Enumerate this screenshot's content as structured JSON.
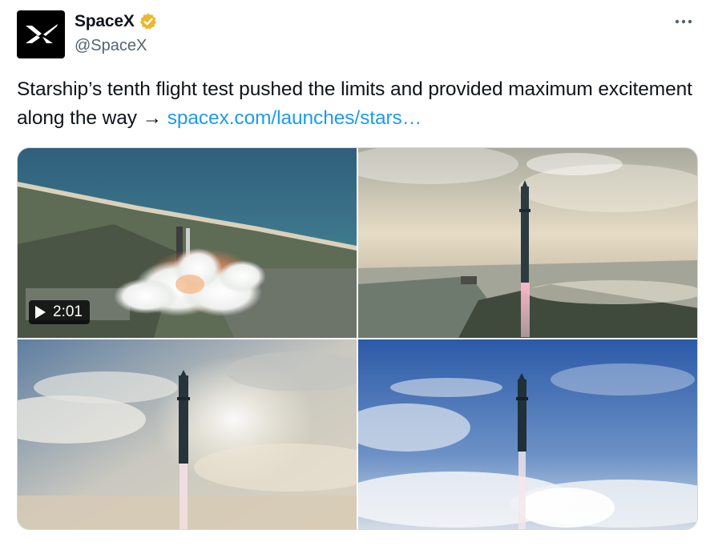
{
  "author": {
    "display_name": "SpaceX",
    "handle": "@SpaceX",
    "verified_badge": "gold-verified-badge-icon",
    "avatar_icon": "spacex-x-logo-icon"
  },
  "tweet": {
    "text": "Starship’s tenth flight test pushed the limits and provided maximum excitement along the way → ",
    "link_text": "spacex.com/launches/stars…"
  },
  "media": {
    "video_duration": "2:01",
    "items": [
      {
        "kind": "video",
        "subject": "launch-pad-liftoff-aerial"
      },
      {
        "kind": "photo",
        "subject": "starship-ascent-over-coast"
      },
      {
        "kind": "photo",
        "subject": "starship-ascent-clouds-sunlit"
      },
      {
        "kind": "photo",
        "subject": "starship-ascent-blue-sky"
      }
    ]
  },
  "colors": {
    "link": "#1d9bf0",
    "secondary_text": "#536471",
    "badge_gold": "#e8b830"
  }
}
